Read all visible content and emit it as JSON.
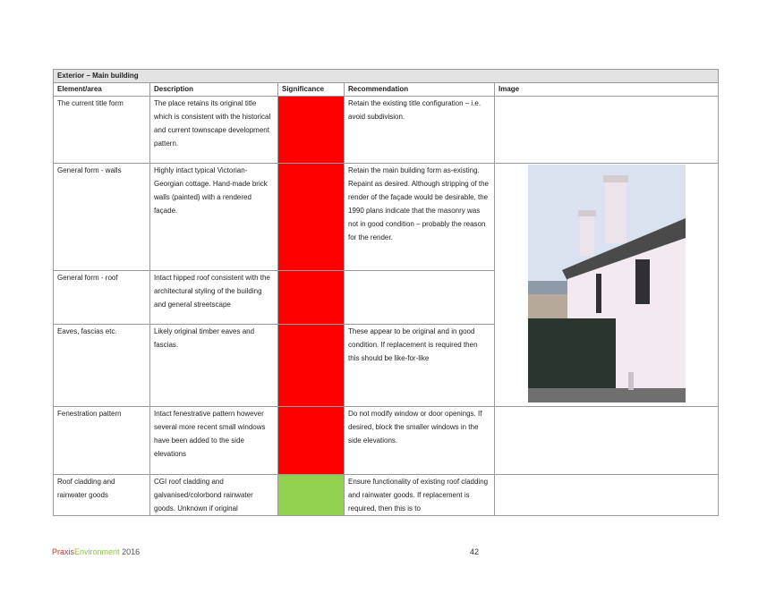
{
  "table": {
    "section_title": "Exterior – Main building",
    "headers": {
      "element": "Element/area",
      "description": "Description",
      "significance": "Significance",
      "recommendation": "Recommendation",
      "image": "Image"
    },
    "rows": [
      {
        "element": "The current title form",
        "description": "The place retains its original title which is consistent with the historical and current townscape development pattern.",
        "significance_color": "#ff0000",
        "recommendation": "Retain the existing title configuration – i.e. avoid subdivision."
      },
      {
        "element": "General form - walls",
        "description": "Highly intact typical Victorian-Georgian cottage. Hand-made brick walls (painted) with a rendered façade.",
        "significance_color": "#ff0000",
        "recommendation": "Retain the main building form as-existing. Repaint as desired. Although stripping of the render of the façade would be desirable, the 1990 plans indicate that the masonry was not in good condition – probably the reason for the render."
      },
      {
        "element": "General form - roof",
        "description": "Intact hipped roof consistent with the architectural styling of the building and general streetscape",
        "significance_color": "#ff0000",
        "recommendation": ""
      },
      {
        "element": "Eaves, fascias etc.",
        "description": "Likely original timber eaves and fascias.",
        "significance_color": "#ff0000",
        "recommendation": "These appear to be original and in good condition. If replacement is required then this should be like-for-like"
      },
      {
        "element": "Fenestration pattern",
        "description": "Intact fenestrative pattern however several more recent small windows have been added to the side elevations",
        "significance_color": "#ff0000",
        "recommendation": "Do not modify window or door openings. If desired, block the smaller windows in the side elevations."
      },
      {
        "element": "Roof cladding and rainwater goods",
        "description": "CGI roof cladding and galvanised/colorbond rainwater goods. Unknown if original",
        "significance_color": "#92d050",
        "recommendation": "Ensure functionality of existing roof cladding and rainwater goods. If replacement is required, then this is to"
      }
    ]
  },
  "footer": {
    "brand_part1": "Praxis",
    "brand_part2": "Environment",
    "year": "2016",
    "page_number": "42"
  },
  "colors": {
    "high_significance": "#ff0000",
    "low_significance": "#92d050",
    "brand_red": "#c0392b",
    "brand_green": "#8cc63f"
  }
}
